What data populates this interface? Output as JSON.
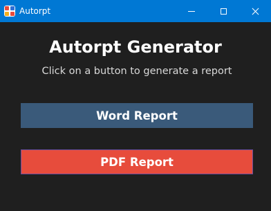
{
  "window": {
    "title": "Autorpt",
    "app_icon": "autorpt-app-icon",
    "controls": [
      "minimize-icon",
      "maximize-icon",
      "close-icon"
    ]
  },
  "main": {
    "heading": "Autorpt Generator",
    "subtitle": "Click on a button to generate a report",
    "buttons": {
      "word_label": "Word Report",
      "pdf_label": "PDF Report"
    }
  },
  "colors": {
    "titlebar": "#0078d4",
    "background": "#1f1f1f",
    "word_button": "#3a5a7a",
    "pdf_button": "#e74c3c"
  }
}
